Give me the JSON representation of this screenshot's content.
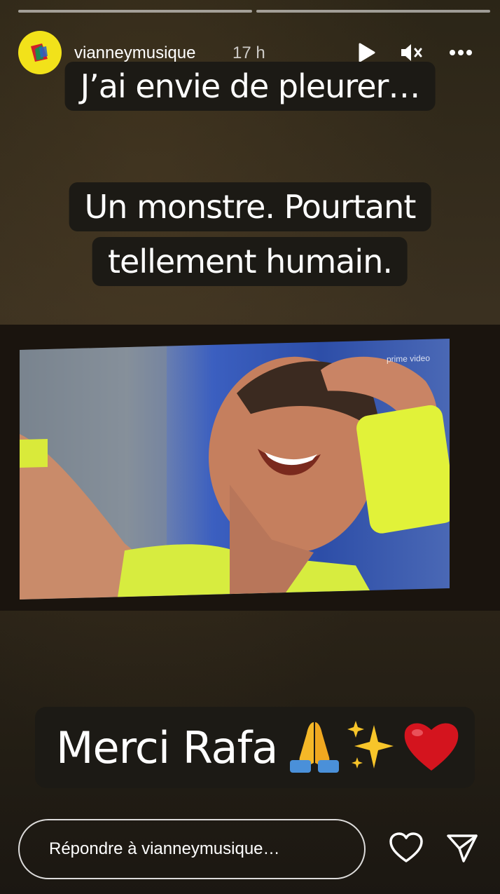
{
  "header": {
    "username": "vianneymusique",
    "time": "17 h",
    "icons": [
      "play-icon",
      "mute-icon",
      "more-icon"
    ]
  },
  "captions": {
    "line1": "J’ai envie de pleurer…",
    "line2a": "Un monstre. Pourtant",
    "line2b": "tellement humain.",
    "line3": "Merci Rafa"
  },
  "photo": {
    "watermark": "prime video"
  },
  "reply": {
    "placeholder": "Répondre à vianneymusique…"
  },
  "colors": {
    "avatar": "#f2e21a",
    "tennis_yellow": "#e4f23a",
    "heart": "#d4141e"
  }
}
